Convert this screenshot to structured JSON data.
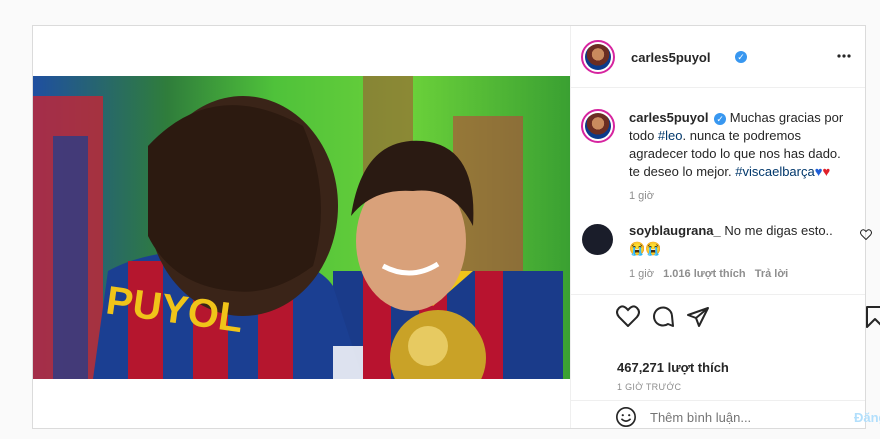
{
  "post": {
    "username": "carles5puyol",
    "photo": {
      "jersey_text": "PUYOL",
      "description": "photo"
    }
  },
  "caption": {
    "username": "carles5puyol",
    "text_before": "Muchas gracias por todo ",
    "tag_leo": "#leo",
    "text_after": ". nunca te podremos agradecer todo lo que nos has dado. te deseo lo mejor. ",
    "tag_visca": "#viscaelbarça",
    "time": "1 giờ"
  },
  "comment": {
    "username": "soyblaugrana_",
    "text": "No me digas esto..",
    "emojis": "😭😭",
    "time": "1 giờ",
    "likes": "1.016 lượt thích",
    "reply": "Trả lời"
  },
  "stats": {
    "likes": "467,271 lượt thích",
    "time_ago": "1 GIỜ TRƯỚC"
  },
  "compose": {
    "placeholder": "Thêm bình luận...",
    "post_button": "Đăng"
  },
  "icons": {
    "verified": "verified-badge-icon",
    "more": "more-options-icon",
    "heart": "heart-icon",
    "comment": "comment-icon",
    "share": "share-icon",
    "save": "bookmark-icon",
    "emoji": "emoji-icon"
  },
  "colors": {
    "link": "#00376b",
    "verified": "#3897f0",
    "post_button": "#b2dffc"
  }
}
